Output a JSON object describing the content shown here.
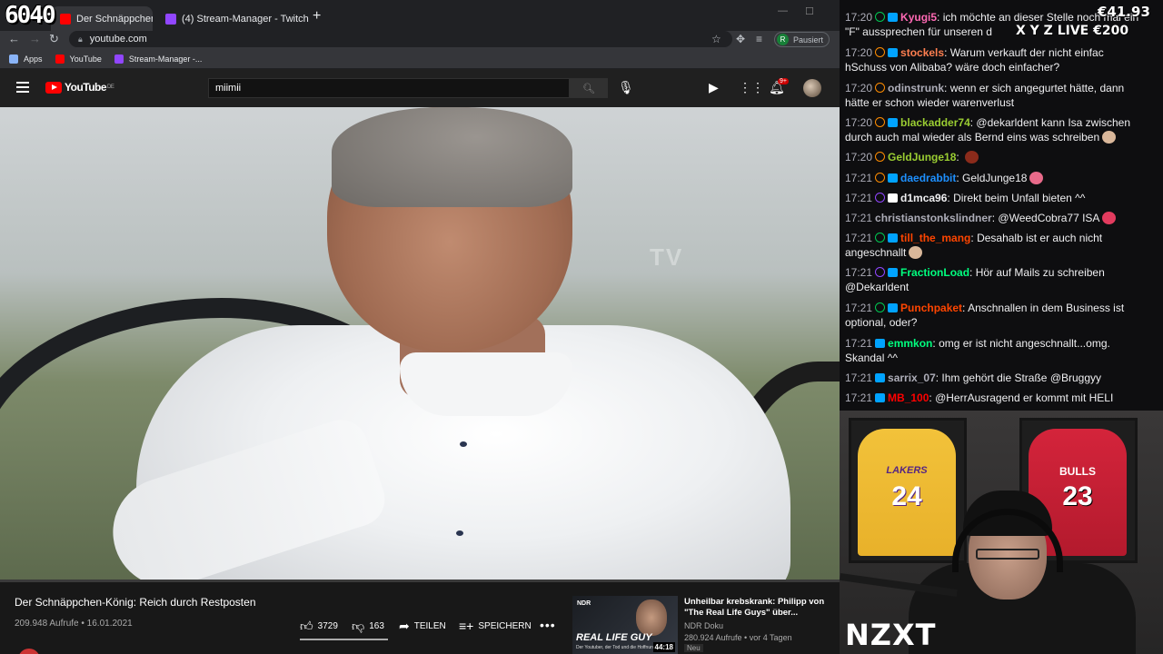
{
  "overlay": {
    "counter": "6040",
    "money_top": "€41.93",
    "xyz_live": "X Y Z LIVE €200",
    "cam_brand": "NZXT"
  },
  "browser": {
    "tabs": [
      {
        "label": "Der Schnäppchen-König: ...",
        "favicon": "youtube-icon",
        "active": true
      },
      {
        "label": "(4) Stream-Manager - Twitch",
        "favicon": "twitch-icon",
        "active": false
      }
    ],
    "address": "youtube.com",
    "profile_initial": "R",
    "profile_status": "Pausiert",
    "bookmarks": [
      {
        "label": "Apps",
        "icon": "apps-grid-icon",
        "color": "#8ab4f8"
      },
      {
        "label": "YouTube",
        "icon": "youtube-icon",
        "color": "#ff0000"
      },
      {
        "label": "Stream-Manager -...",
        "icon": "twitch-icon",
        "color": "#9146ff"
      }
    ]
  },
  "youtube": {
    "logo_text": "YouTube",
    "logo_country": "DE",
    "search_value": "miimii",
    "notification_count": "9+",
    "video_watermark": "TV",
    "video": {
      "title": "Der Schnäppchen-König: Reich durch Restposten",
      "meta": "209.948 Aufrufe • 16.01.2021",
      "likes": "3729",
      "dislikes": "163",
      "share_label": "TEILEN",
      "save_label": "SPEICHERN"
    },
    "recommended": {
      "title": "Unheilbar krebskrank: Philipp von \"The Real Life Guys\" über...",
      "channel": "NDR Doku",
      "views": "280.924 Aufrufe • vor 4 Tagen",
      "badge": "Neu",
      "duration": "44:18",
      "thumb_logo": "NDR",
      "thumb_text": "REAL LIFE GUY",
      "thumb_sub": "Der Youtuber, der Tod und die Hoffnung"
    }
  },
  "chat": {
    "messages": [
      {
        "time": "17:20",
        "user": "Kyugi5",
        "user_color": "#ff69b4",
        "text": "ich möchte an dieser Stelle noch mal ein \"F\" aussprechen für unseren d"
      },
      {
        "time": "17:20",
        "user": "stockels",
        "user_color": "#ff7f50",
        "text": "Warum verkauft der nicht einfac hSchuss von Alibaba? wäre doch einfacher?"
      },
      {
        "time": "17:20",
        "user": "odinstrunk",
        "user_color": "#adadb8",
        "text": "wenn er sich angegurtet hätte, dann hätte er schon wieder warenverlust"
      },
      {
        "time": "17:20",
        "user": "blackadder74",
        "user_color": "#9acd32",
        "text": "@dekarldent kann Isa zwischen durch auch mal wieder als Bernd eins was schreiben"
      },
      {
        "time": "17:20",
        "user": "GeldJunge18",
        "user_color": "#9acd32",
        "text": ""
      },
      {
        "time": "17:21",
        "user": "daedrabbit",
        "user_color": "#1e90ff",
        "text": "GeldJunge18"
      },
      {
        "time": "17:21",
        "user": "d1mca96",
        "user_color": "#efeff1",
        "text": "Direkt beim Unfall bieten ^^"
      },
      {
        "time": "17:21",
        "user": "christianstonkslindner",
        "user_color": "#adadb8",
        "text": "@WeedCobra77 ISA"
      },
      {
        "time": "17:21",
        "user": "till_the_mang",
        "user_color": "#ff4500",
        "text": "Desahalb ist er auch nicht angeschnallt"
      },
      {
        "time": "17:21",
        "user": "FractionLoad",
        "user_color": "#00ff7f",
        "text": "Hör auf Mails zu schreiben @Dekarldent"
      },
      {
        "time": "17:21",
        "user": "Punchpaket",
        "user_color": "#ff4500",
        "text": "Anschnallen in dem Business ist optional, oder?"
      },
      {
        "time": "17:21",
        "user": "emmkon",
        "user_color": "#00ff7f",
        "text": "omg er ist nicht angeschnallt...omg. Skandal ^^"
      },
      {
        "time": "17:21",
        "user": "sarrix_07",
        "user_color": "#adadb8",
        "text": "Ihm gehört die Straße @Bruggyy"
      },
      {
        "time": "17:21",
        "user": "MB_100",
        "user_color": "#ff0000",
        "text": "@HerrAusragend er kommt mit HELI"
      }
    ]
  },
  "webcam": {
    "jersey_left_team": "LAKERS",
    "jersey_left_number": "24",
    "jersey_right_team": "BULLS",
    "jersey_right_number": "23"
  }
}
